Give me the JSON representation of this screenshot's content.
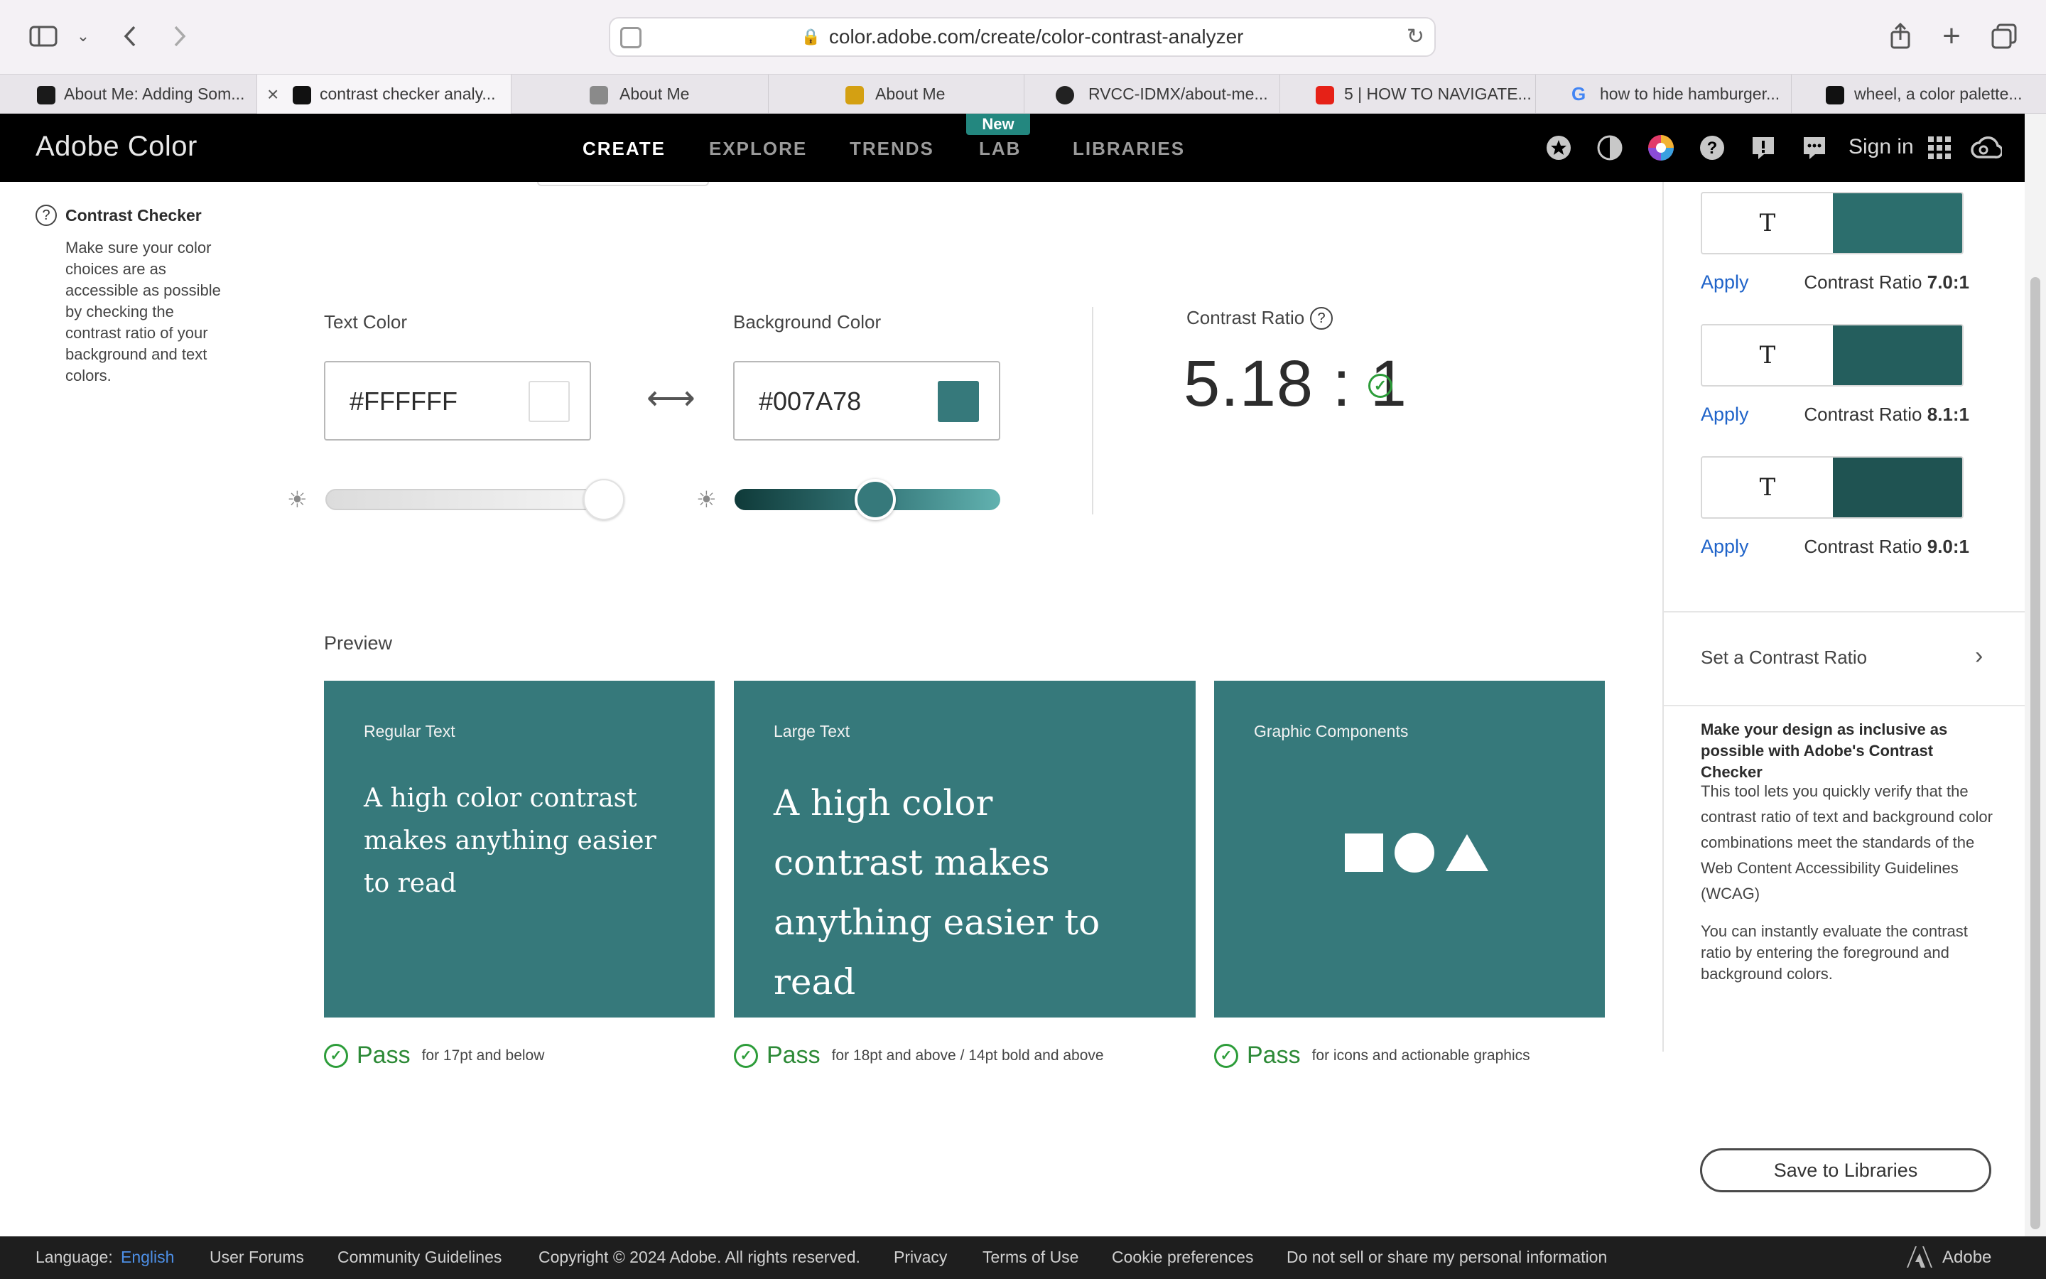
{
  "browser": {
    "url": "color.adobe.com/create/color-contrast-analyzer",
    "tabs": [
      {
        "label": "About Me: Adding Som...",
        "favicon_color": "#1a1a1a"
      },
      {
        "label": "contrast checker analy...",
        "favicon_color": "#111111",
        "active": true
      },
      {
        "label": "About Me",
        "favicon_color": "#8a8a8a"
      },
      {
        "label": "About Me",
        "favicon_color": "#d4a012"
      },
      {
        "label": "RVCC-IDMX/about-me...",
        "favicon_color": "#222222"
      },
      {
        "label": "5 | HOW TO NAVIGATE...",
        "favicon_color": "#e62117"
      },
      {
        "label": "how to hide hamburger...",
        "favicon_color": "#4285f4"
      },
      {
        "label": "wheel, a color palette...",
        "favicon_color": "#111111"
      }
    ],
    "tab_close": "×"
  },
  "header": {
    "brand": "Adobe Color",
    "nav": [
      {
        "label": "CREATE",
        "active": true
      },
      {
        "label": "EXPLORE"
      },
      {
        "label": "TRENDS"
      },
      {
        "label": "LAB"
      },
      {
        "label": "LIBRARIES"
      }
    ],
    "new_badge": "New",
    "sign_in": "Sign in"
  },
  "sidebar": {
    "help_glyph": "?",
    "title": "Contrast Checker",
    "description": "Make sure your color choices are as accessible as possible by checking the contrast ratio of your background and text colors."
  },
  "checker": {
    "text_color_label": "Text Color",
    "text_color_value": "#FFFFFF",
    "text_color_swatch": "#FFFFFF",
    "background_color_label": "Background Color",
    "background_color_value": "#007A78",
    "background_color_swatch": "#36797B",
    "text_brightness": 1.0,
    "background_brightness": 0.53,
    "contrast_ratio_label": "Contrast Ratio",
    "contrast_ratio_value": "5.18 : 1"
  },
  "preview": {
    "label": "Preview",
    "card_color": "#36797B",
    "cards": [
      {
        "title": "Regular Text",
        "text": "A high color contrast makes anything easier to read"
      },
      {
        "title": "Large Text",
        "text": "A high color contrast makes anything easier to read"
      },
      {
        "title": "Graphic Components"
      }
    ],
    "results": [
      {
        "status": "Pass",
        "note": "for 17pt and below"
      },
      {
        "status": "Pass",
        "note": "for 18pt and above / 14pt bold and above"
      },
      {
        "status": "Pass",
        "note": "for icons and actionable graphics"
      }
    ]
  },
  "suggestions": {
    "swatch_letter": "T",
    "items": [
      {
        "color": "#2C6E6D",
        "apply": "Apply",
        "ratio_prefix": "Contrast Ratio ",
        "ratio": "7.0:1"
      },
      {
        "color": "#245E5D",
        "apply": "Apply",
        "ratio_prefix": "Contrast Ratio ",
        "ratio": "8.1:1"
      },
      {
        "color": "#1F5352",
        "apply": "Apply",
        "ratio_prefix": "Contrast Ratio ",
        "ratio": "9.0:1"
      }
    ],
    "set_ratio": "Set a Contrast Ratio",
    "inclusive_title": "Make your design as inclusive as possible with Adobe's Contrast Checker",
    "para1": "This tool lets you quickly verify that the contrast ratio of text and background color combinations meet the standards of the Web Content Accessibility Guidelines (WCAG)",
    "para2": "You can instantly evaluate the contrast ratio by entering the foreground and background colors.",
    "save_button": "Save to Libraries"
  },
  "footer": {
    "language_label": "Language:",
    "language_value": "English",
    "links": [
      "User Forums",
      "Community Guidelines",
      "Copyright © 2024 Adobe. All rights reserved.",
      "Privacy",
      "Terms of Use",
      "Cookie preferences",
      "Do not sell or share my personal information"
    ],
    "adobe": "Adobe"
  }
}
